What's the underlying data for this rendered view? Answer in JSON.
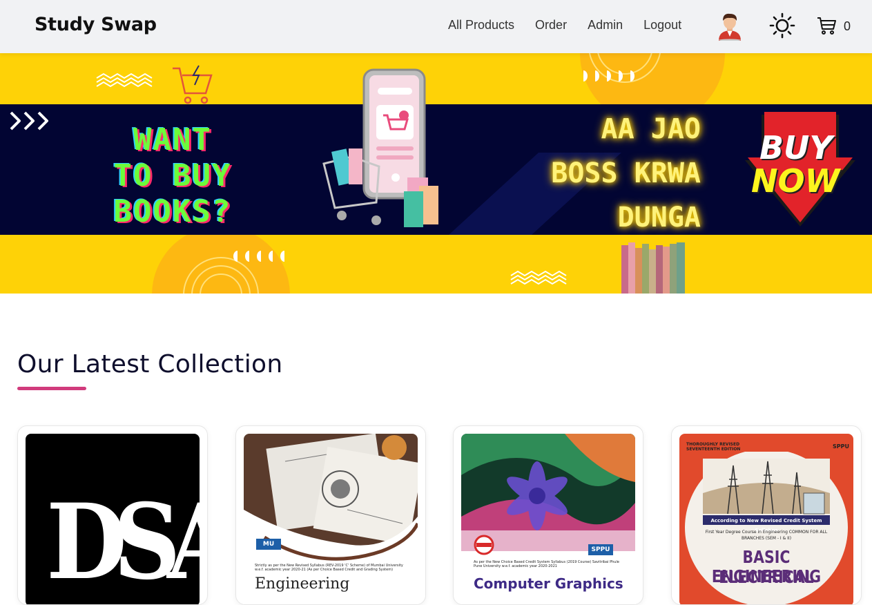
{
  "navbar": {
    "brand": "Study Swap",
    "links": [
      "All Products",
      "Order",
      "Admin",
      "Logout"
    ],
    "cart_count": "0"
  },
  "banner": {
    "left_lines": [
      "WANT",
      "TO BUY",
      "BOOKS?"
    ],
    "right_lines": [
      "AA JAO",
      "BOSS KRWA",
      "DUNGA"
    ],
    "buy": "BUY",
    "now": "NOW"
  },
  "section": {
    "title": "Our Latest Collection"
  },
  "products": [
    {
      "cover_text": "DSA"
    },
    {
      "badge": "MU",
      "subtitle": "Strictly as per the New Revised Syllabus (REV-2019 'C' Scheme) of Mumbai University w.e.f. academic year 2020-21 (As per Choice Based Credit and Grading System)",
      "title": "Engineering"
    },
    {
      "badge": "SPPU",
      "subtitle": "As per the New Choice Based Credit System Syllabus (2019 Course) Savitribai Phule Pune University w.e.f. academic year 2020-2021",
      "title": "Computer Graphics"
    },
    {
      "edition": "THOROUGHLY REVISED SEVENTEENTH EDITION",
      "badge": "SPPU",
      "syllabus": "According to New Revised Credit System Syllabus",
      "course": "First Year Degree Course in Engineering COMMON FOR ALL BRANCHES (SEM - I & II)",
      "title_line1": "BASIC ELECTRICAL",
      "title_line2": "ENGINEERING"
    }
  ]
}
